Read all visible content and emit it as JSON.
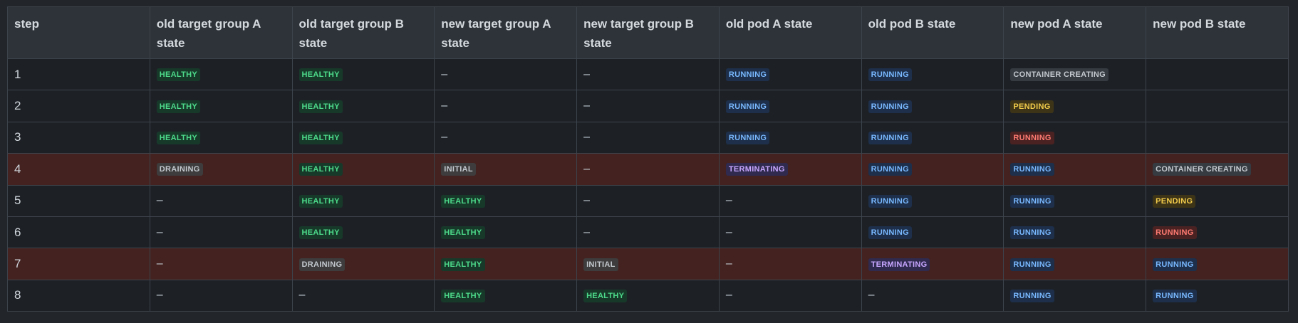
{
  "table": {
    "headers": [
      "step",
      "old target group A state",
      "old target group B state",
      "new target group A state",
      "new target group B state",
      "old pod A state",
      "old pod B state",
      "new pod A state",
      "new pod B state"
    ],
    "rows": [
      {
        "step": "1",
        "highlighted": false,
        "cells": [
          {
            "text": "HEALTHY",
            "kind": "healthy"
          },
          {
            "text": "HEALTHY",
            "kind": "healthy"
          },
          {
            "text": "–",
            "kind": "dash"
          },
          {
            "text": "–",
            "kind": "dash"
          },
          {
            "text": "RUNNING",
            "kind": "running"
          },
          {
            "text": "RUNNING",
            "kind": "running"
          },
          {
            "text": "CONTAINER CREATING",
            "kind": "container"
          },
          {
            "text": "",
            "kind": "empty"
          }
        ]
      },
      {
        "step": "2",
        "highlighted": false,
        "cells": [
          {
            "text": "HEALTHY",
            "kind": "healthy"
          },
          {
            "text": "HEALTHY",
            "kind": "healthy"
          },
          {
            "text": "–",
            "kind": "dash"
          },
          {
            "text": "–",
            "kind": "dash"
          },
          {
            "text": "RUNNING",
            "kind": "running"
          },
          {
            "text": "RUNNING",
            "kind": "running"
          },
          {
            "text": "PENDING",
            "kind": "pending"
          },
          {
            "text": "",
            "kind": "empty"
          }
        ]
      },
      {
        "step": "3",
        "highlighted": false,
        "cells": [
          {
            "text": "HEALTHY",
            "kind": "healthy"
          },
          {
            "text": "HEALTHY",
            "kind": "healthy"
          },
          {
            "text": "–",
            "kind": "dash"
          },
          {
            "text": "–",
            "kind": "dash"
          },
          {
            "text": "RUNNING",
            "kind": "running"
          },
          {
            "text": "RUNNING",
            "kind": "running"
          },
          {
            "text": "RUNNING",
            "kind": "running-red"
          },
          {
            "text": "",
            "kind": "empty"
          }
        ]
      },
      {
        "step": "4",
        "highlighted": true,
        "cells": [
          {
            "text": "DRAINING",
            "kind": "draining"
          },
          {
            "text": "HEALTHY",
            "kind": "healthy"
          },
          {
            "text": "INITIAL",
            "kind": "initial"
          },
          {
            "text": "–",
            "kind": "dash"
          },
          {
            "text": "TERMINATING",
            "kind": "terminating"
          },
          {
            "text": "RUNNING",
            "kind": "running"
          },
          {
            "text": "RUNNING",
            "kind": "running"
          },
          {
            "text": "CONTAINER CREATING",
            "kind": "container"
          }
        ]
      },
      {
        "step": "5",
        "highlighted": false,
        "cells": [
          {
            "text": "–",
            "kind": "dash"
          },
          {
            "text": "HEALTHY",
            "kind": "healthy"
          },
          {
            "text": "HEALTHY",
            "kind": "healthy"
          },
          {
            "text": "–",
            "kind": "dash"
          },
          {
            "text": "–",
            "kind": "dash"
          },
          {
            "text": "RUNNING",
            "kind": "running"
          },
          {
            "text": "RUNNING",
            "kind": "running"
          },
          {
            "text": "PENDING",
            "kind": "pending"
          }
        ]
      },
      {
        "step": "6",
        "highlighted": false,
        "cells": [
          {
            "text": "–",
            "kind": "dash"
          },
          {
            "text": "HEALTHY",
            "kind": "healthy"
          },
          {
            "text": "HEALTHY",
            "kind": "healthy"
          },
          {
            "text": "–",
            "kind": "dash"
          },
          {
            "text": "–",
            "kind": "dash"
          },
          {
            "text": "RUNNING",
            "kind": "running"
          },
          {
            "text": "RUNNING",
            "kind": "running"
          },
          {
            "text": "RUNNING",
            "kind": "running-red"
          }
        ]
      },
      {
        "step": "7",
        "highlighted": true,
        "cells": [
          {
            "text": "–",
            "kind": "dash"
          },
          {
            "text": "DRAINING",
            "kind": "draining"
          },
          {
            "text": "HEALTHY",
            "kind": "healthy"
          },
          {
            "text": "INITIAL",
            "kind": "initial"
          },
          {
            "text": "–",
            "kind": "dash"
          },
          {
            "text": "TERMINATING",
            "kind": "terminating"
          },
          {
            "text": "RUNNING",
            "kind": "running"
          },
          {
            "text": "RUNNING",
            "kind": "running"
          }
        ]
      },
      {
        "step": "8",
        "highlighted": false,
        "cells": [
          {
            "text": "–",
            "kind": "dash"
          },
          {
            "text": "–",
            "kind": "dash"
          },
          {
            "text": "HEALTHY",
            "kind": "healthy"
          },
          {
            "text": "HEALTHY",
            "kind": "healthy"
          },
          {
            "text": "–",
            "kind": "dash"
          },
          {
            "text": "–",
            "kind": "dash"
          },
          {
            "text": "RUNNING",
            "kind": "running"
          },
          {
            "text": "RUNNING",
            "kind": "running"
          }
        ]
      }
    ]
  },
  "colors": {
    "background": "#22262b",
    "header_bg": "#2d3339",
    "row_bg": "#1d2126",
    "highlight_row_bg": "#432220",
    "healthy": "#4ddb8a",
    "running": "#79b8ff",
    "running_red": "#ff7b72",
    "pending": "#f2cc4a",
    "terminating": "#c8a6ff"
  }
}
